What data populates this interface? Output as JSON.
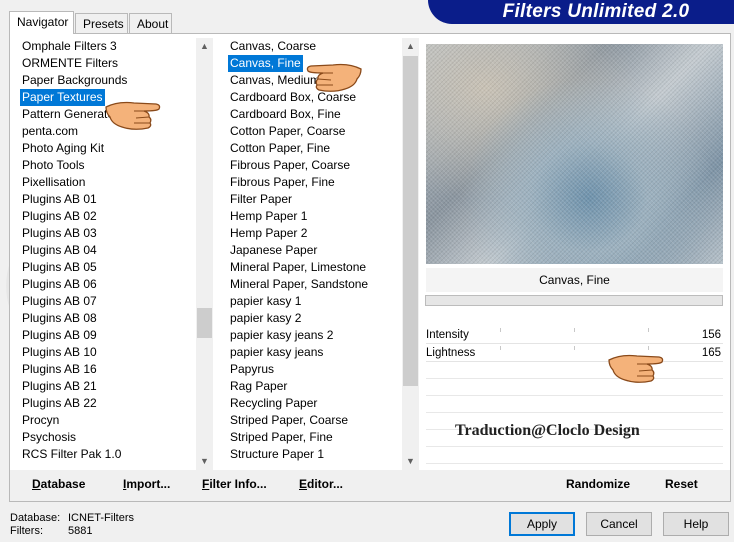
{
  "tabs": [
    {
      "label": "Navigator",
      "active": true
    },
    {
      "label": "Presets",
      "active": false
    },
    {
      "label": "About",
      "active": false
    }
  ],
  "app_title": "Filters Unlimited 2.0",
  "categories": [
    "Omphale Filters 3",
    "ORMENTE Filters",
    "Paper Backgrounds",
    "Paper Textures",
    "Pattern Generators",
    "penta.com",
    "Photo Aging Kit",
    "Photo Tools",
    "Pixellisation",
    "Plugins AB 01",
    "Plugins AB 02",
    "Plugins AB 03",
    "Plugins AB 04",
    "Plugins AB 05",
    "Plugins AB 06",
    "Plugins AB 07",
    "Plugins AB 08",
    "Plugins AB 09",
    "Plugins AB 10",
    "Plugins AB 16",
    "Plugins AB 21",
    "Plugins AB 22",
    "Procyn",
    "Psychosis",
    "RCS Filter Pak 1.0"
  ],
  "selected_category": "Paper Textures",
  "filters": [
    "Canvas, Coarse",
    "Canvas, Fine",
    "Canvas, Medium",
    "Cardboard Box, Coarse",
    "Cardboard Box, Fine",
    "Cotton Paper, Coarse",
    "Cotton Paper, Fine",
    "Fibrous Paper, Coarse",
    "Fibrous Paper, Fine",
    "Filter Paper",
    "Hemp Paper 1",
    "Hemp Paper 2",
    "Japanese Paper",
    "Mineral Paper, Limestone",
    "Mineral Paper, Sandstone",
    "papier kasy 1",
    "papier kasy 2",
    "papier kasy jeans 2",
    "papier kasy jeans",
    "Papyrus",
    "Rag Paper",
    "Recycling Paper",
    "Striped Paper, Coarse",
    "Striped Paper, Fine",
    "Structure Paper 1"
  ],
  "selected_filter": "Canvas, Fine",
  "parameters": [
    {
      "label": "Intensity",
      "value": "156"
    },
    {
      "label": "Lightness",
      "value": "165"
    }
  ],
  "buttons": {
    "database": {
      "u": "D",
      "rest": "atabase"
    },
    "import": {
      "u": "I",
      "rest": "mport..."
    },
    "filter_info": {
      "u": "F",
      "rest": "ilter Info..."
    },
    "editor": {
      "u": "E",
      "rest": "ditor..."
    },
    "randomize": "Randomize",
    "reset": "Reset",
    "apply": "Apply",
    "cancel": "Cancel",
    "help": "Help"
  },
  "status": {
    "database_label": "Database:",
    "database_value": "ICNET-Filters",
    "filters_label": "Filters:",
    "filters_value": "5881"
  },
  "credit_text": "Traduction@Cloclo Design",
  "colors": {
    "selection": "#0078d7",
    "title_banner": "#0a1d8a",
    "hand_skin": "#f4b27a",
    "hand_outline": "#8a4a1a"
  },
  "icons": [
    "pointing-hand-icon",
    "scroll-up-arrow-icon",
    "scroll-down-arrow-icon"
  ]
}
